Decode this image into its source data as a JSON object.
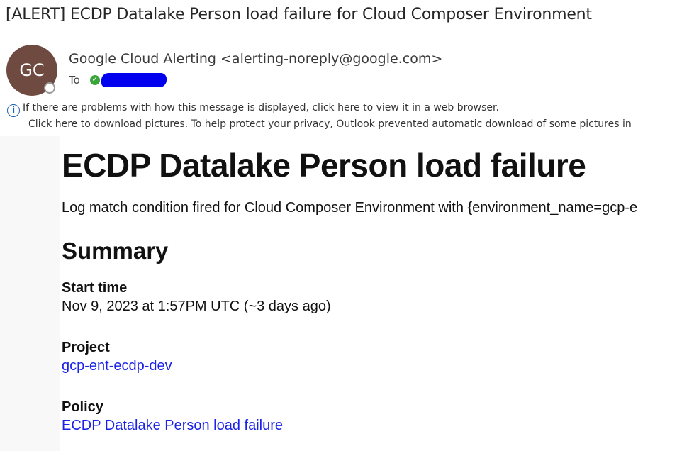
{
  "email": {
    "subject": "[ALERT] ECDP Datalake Person load failure for Cloud Composer Environment",
    "avatar_initials": "GC",
    "sender": "Google Cloud Alerting <alerting-noreply@google.com>",
    "to_label": "To",
    "info_icon": "info-icon",
    "info_line1": "If there are problems with how this message is displayed, click here to view it in a web browser.",
    "info_line2": "Click here to download pictures. To help protect your privacy, Outlook prevented automatic download of some pictures in"
  },
  "alert": {
    "heading": "ECDP Datalake Person load failure",
    "description": "Log match condition fired for Cloud Composer Environment with {environment_name=gcp-e",
    "summary_title": "Summary",
    "start_time_label": "Start time",
    "start_time_value": "Nov 9, 2023 at 1:57PM UTC (~3 days ago)",
    "project_label": "Project",
    "project_value": "gcp-ent-ecdp-dev",
    "policy_label": "Policy",
    "policy_value": "ECDP Datalake Person load failure"
  },
  "colors": {
    "avatar_bg": "#6e4a41",
    "link": "#1a22e8",
    "redaction": "#0000ee",
    "status_ok": "#3aa63a"
  }
}
